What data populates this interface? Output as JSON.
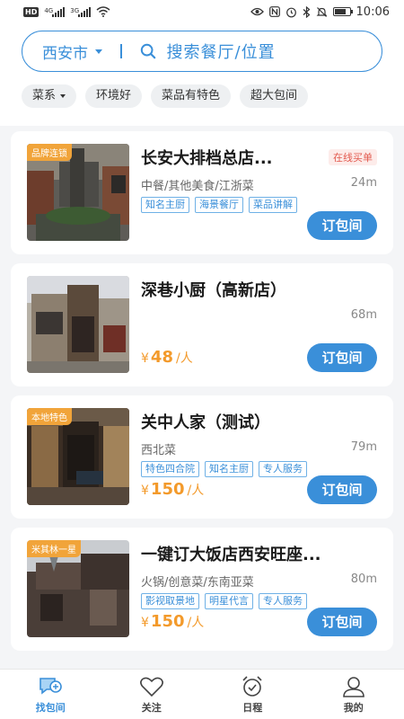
{
  "status_bar": {
    "hd": "HD",
    "net1": "4G",
    "net2": "3G",
    "time": "10:06",
    "battery_level": 0.8
  },
  "search": {
    "city": "西安市",
    "placeholder": "搜索餐厅/位置"
  },
  "filters": [
    {
      "label": "菜系"
    },
    {
      "label": "环境好"
    },
    {
      "label": "菜品有特色"
    },
    {
      "label": "超大包间"
    }
  ],
  "restaurants": [
    {
      "badge": "品牌连锁",
      "name": "长安大排档总店...",
      "online_tag": "在线买单",
      "category": "中餐/其他美食/江浙菜",
      "distance": "24m",
      "tags": [
        "知名主厨",
        "海景餐厅",
        "菜品讲解"
      ],
      "book_label": "订包间"
    },
    {
      "name": "深巷小厨（高新店）",
      "distance": "68m",
      "price_symbol": "¥",
      "price": "48",
      "price_unit": "/人",
      "book_label": "订包间"
    },
    {
      "badge": "本地特色",
      "name": "关中人家（测试）",
      "category": "西北菜",
      "distance": "79m",
      "tags": [
        "特色四合院",
        "知名主厨",
        "专人服务"
      ],
      "price_symbol": "¥",
      "price": "150",
      "price_unit": "/人",
      "book_label": "订包间"
    },
    {
      "badge": "米其林一星",
      "name": "一键订大饭店西安旺座...",
      "category": "火锅/创意菜/东南亚菜",
      "distance": "80m",
      "tags": [
        "影视取景地",
        "明星代言",
        "专人服务"
      ],
      "price_symbol": "¥",
      "price": "150",
      "price_unit": "/人",
      "book_label": "订包间"
    }
  ],
  "tabbar": [
    {
      "label": "找包间",
      "icon": "chat-map-icon",
      "active": true
    },
    {
      "label": "关注",
      "icon": "heart-icon"
    },
    {
      "label": "日程",
      "icon": "alarm-clock-icon"
    },
    {
      "label": "我的",
      "icon": "person-icon"
    }
  ],
  "colors": {
    "accent": "#3a8fd9",
    "price": "#f39a2b",
    "badge": "#f1a43a",
    "online_tag": "#e25a4f"
  }
}
